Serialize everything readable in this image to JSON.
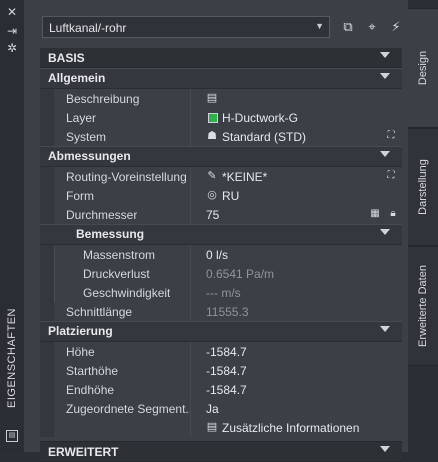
{
  "rail": {
    "title": "EIGENSCHAFTEN"
  },
  "toolbar": {
    "selector_value": "Luftkanal/-rohr"
  },
  "sections": {
    "basis": "BASIS",
    "allgemein": "Allgemein",
    "abmessungen": "Abmessungen",
    "bemessung": "Bemessung",
    "platzierung": "Platzierung",
    "erweitert": "ERWEITERT"
  },
  "props": {
    "beschreibung": {
      "label": "Beschreibung",
      "value": ""
    },
    "layer": {
      "label": "Layer",
      "value": "H-Ductwork-G"
    },
    "system": {
      "label": "System",
      "value": "Standard (STD)"
    },
    "routing": {
      "label": "Routing-Voreinstellung",
      "value": "*KEINE*"
    },
    "form": {
      "label": "Form",
      "value": "RU"
    },
    "durchmesser": {
      "label": "Durchmesser",
      "value": "75"
    },
    "massenstrom": {
      "label": "Massenstrom",
      "value": "0 l/s"
    },
    "druckverlust": {
      "label": "Druckverlust",
      "value": "0.6541 Pa/m"
    },
    "geschwindigkeit": {
      "label": "Geschwindigkeit",
      "value": "--- m/s"
    },
    "schnittlaenge": {
      "label": "Schnittlänge",
      "value": "11555.3"
    },
    "hoehe": {
      "label": "Höhe",
      "value": "-1584.7"
    },
    "starthoehe": {
      "label": "Starthöhe",
      "value": "-1584.7"
    },
    "endhoehe": {
      "label": "Endhöhe",
      "value": "-1584.7"
    },
    "zugeordnete": {
      "label": "Zugeordnete Segment...",
      "value": "Ja"
    },
    "zusaetzliche": {
      "label": "",
      "value": "Zusätzliche Informationen"
    }
  },
  "tabs": {
    "design": "Design",
    "darstellung": "Darstellung",
    "erweiterte": "Erweiterte Daten"
  },
  "colors": {
    "layer_swatch": "#2db34a"
  },
  "icons": {
    "rail_close": "close-icon",
    "rail_autohide": "pin-icon",
    "rail_settings": "settings-icon",
    "toolbar_add": "add-selection-icon",
    "toolbar_select": "select-objects-icon",
    "toolbar_quickselect": "quick-select-icon"
  }
}
